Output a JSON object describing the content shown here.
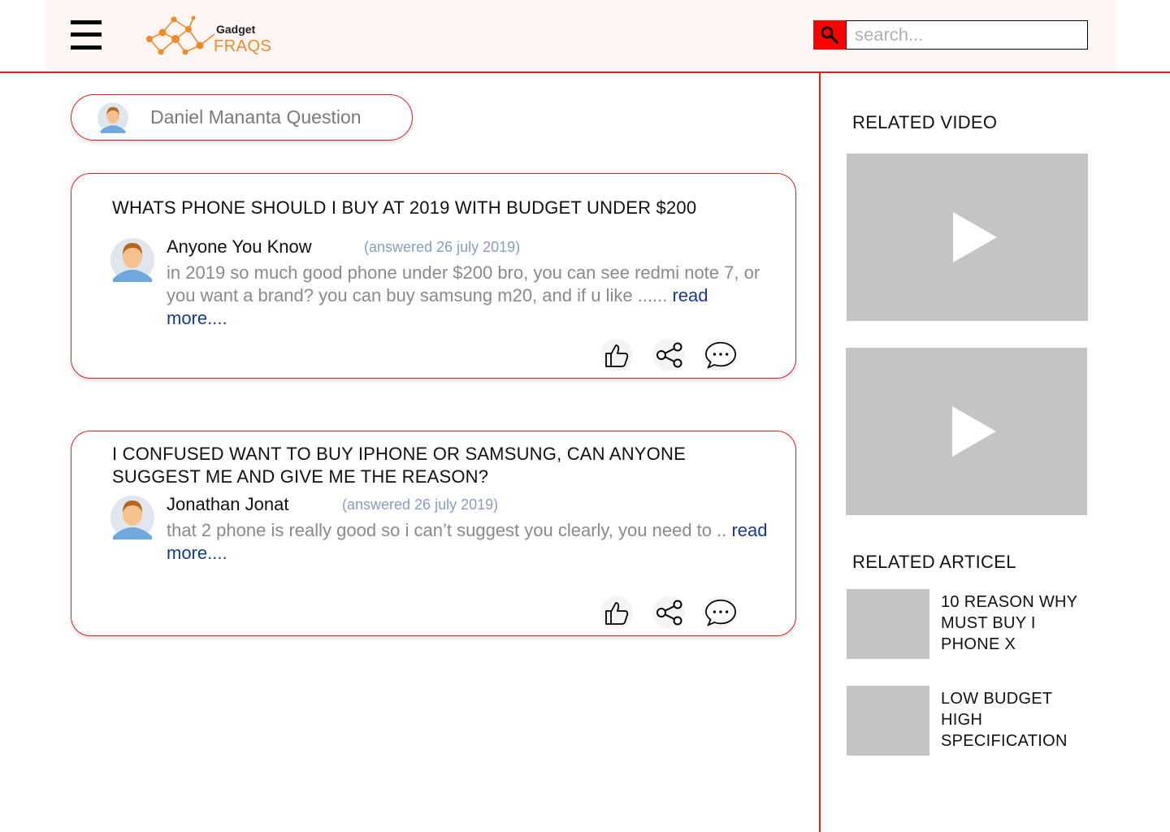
{
  "header": {
    "logo_top": "Gadget",
    "logo_bottom": "FRAQS",
    "search_placeholder": "search..."
  },
  "question_button": {
    "label": "Daniel Mananta Question"
  },
  "questions": [
    {
      "title": "WHATS PHONE SHOULD I BUY AT 2019 WITH BUDGET UNDER $200",
      "answerer": "Anyone You Know",
      "date": "(answered 26 july 2019)",
      "excerpt": "in 2019 so much good phone under $200 bro, you can see redmi note 7, or you want a brand? you can buy samsung m20, and if u like ......",
      "read_more": "read more...."
    },
    {
      "title": "I CONFUSED WANT TO BUY IPHONE OR SAMSUNG, CAN ANYONE SUGGEST ME AND GIVE ME THE REASON?",
      "answerer": "Jonathan Jonat",
      "date": "(answered 26 july 2019)",
      "excerpt": "that 2 phone is really good so i can’t suggest you clearly, you need to ..",
      "read_more": "read more...."
    }
  ],
  "actions": [
    "thumbs-up-icon",
    "share-icon",
    "comment-icon"
  ],
  "sidebar": {
    "related_video_heading": "RELATED VIDEO",
    "related_article_heading": "RELATED ARTICEL",
    "articles": [
      {
        "title": "10 REASON WHY MUST BUY I PHONE X"
      },
      {
        "title": "LOW BUDGET HIGH SPECIFICATION"
      }
    ]
  },
  "colors": {
    "accent": "#e02020",
    "search_button": "#ff0000",
    "logo_orange": "#f08a2a",
    "link_blue": "#1a3a8a",
    "date_blue": "#8a9cc4",
    "placeholder_gray": "#c4c4c4",
    "header_bg": "#fdf6f4"
  }
}
